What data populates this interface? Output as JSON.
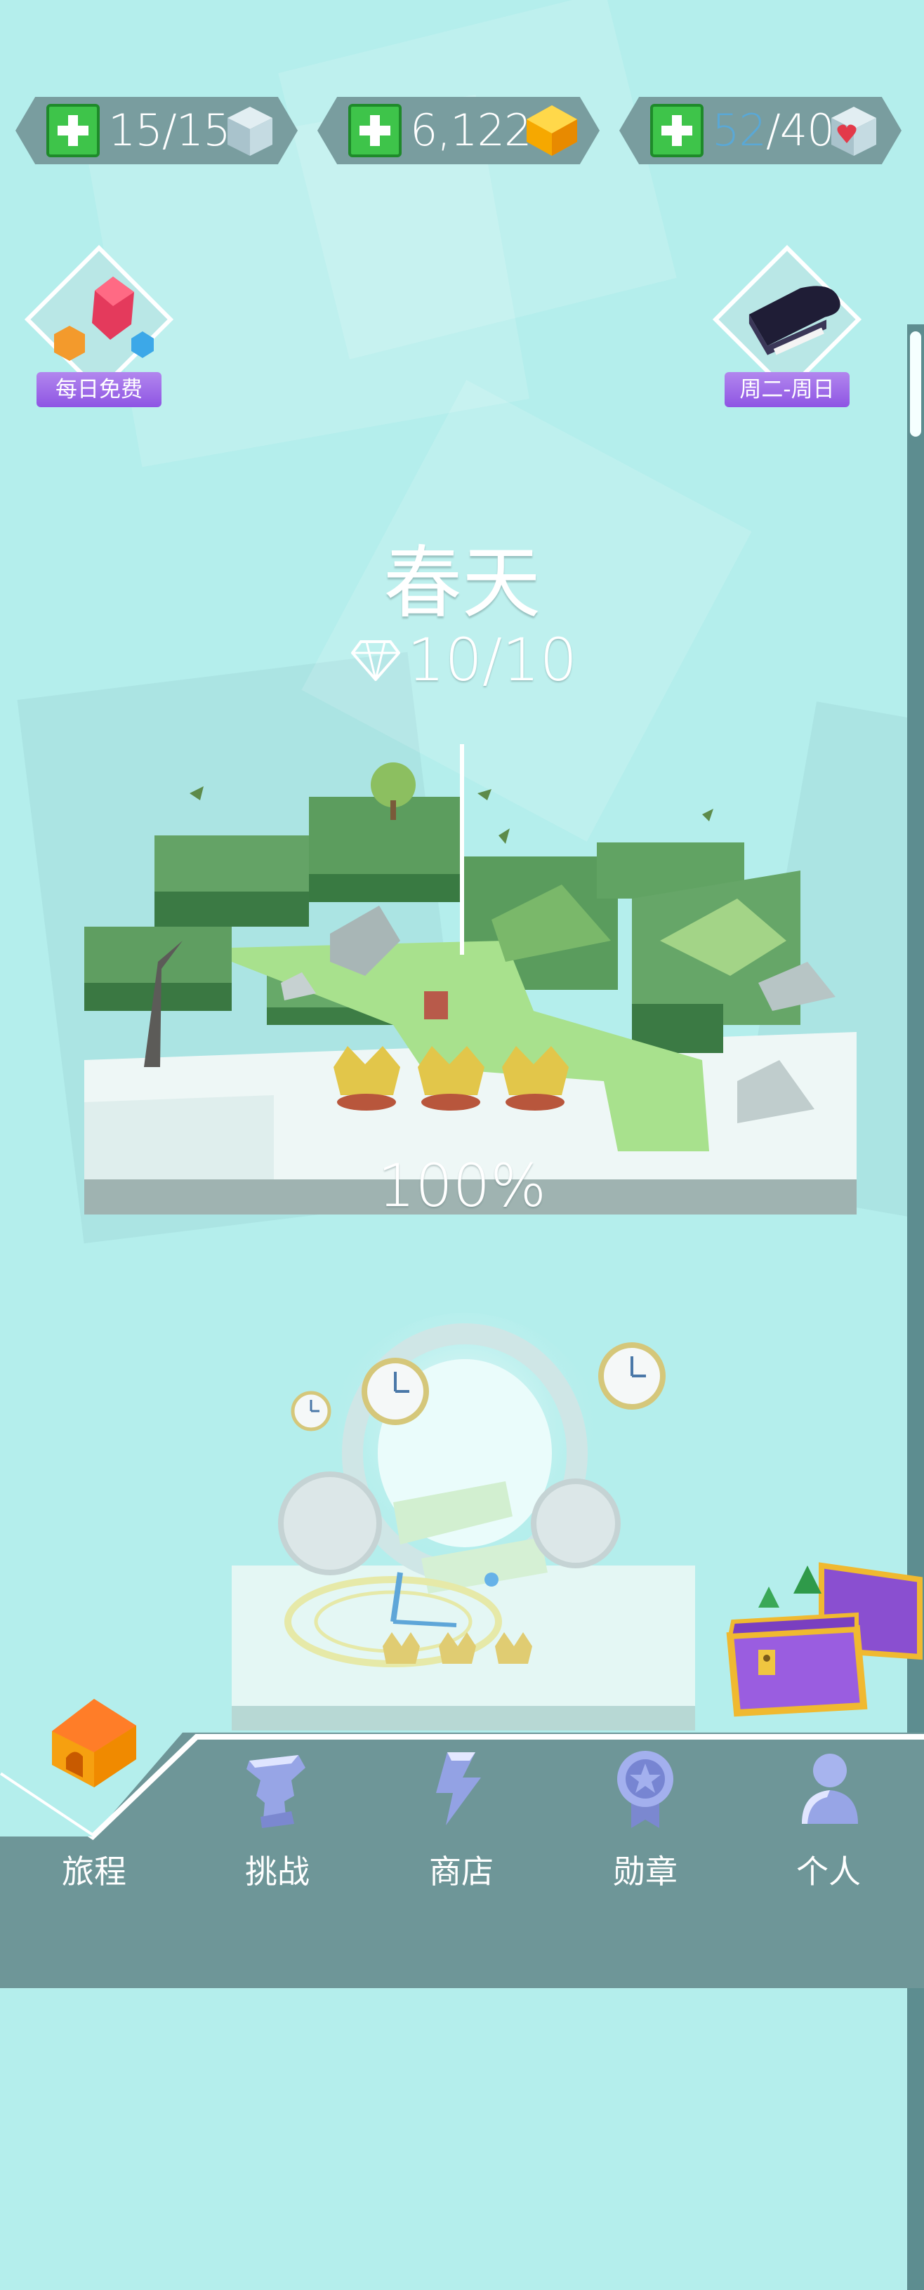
{
  "resources": [
    {
      "current": "15",
      "max": "15",
      "sep": "/",
      "icon": "cube-icon"
    },
    {
      "value": "6,122",
      "icon": "gold-gem-icon"
    },
    {
      "current": "52",
      "max": "40",
      "sep": "/",
      "icon": "heart-cube-icon"
    }
  ],
  "badges": {
    "left": {
      "label": "每日免费",
      "icon": "gems-icon"
    },
    "right": {
      "label": "周二-周日",
      "icon": "piano-icon"
    }
  },
  "level": {
    "title": "春天",
    "gems": "10/10",
    "progress_text": "100%",
    "progress": 1.0
  },
  "nav": [
    {
      "label": "旅程",
      "icon": "house-icon"
    },
    {
      "label": "挑战",
      "icon": "trophy-icon"
    },
    {
      "label": "商店",
      "icon": "shop-icon"
    },
    {
      "label": "勋章",
      "icon": "medal-icon"
    },
    {
      "label": "个人",
      "icon": "person-icon"
    }
  ],
  "colors": {
    "background": "#b4eeec",
    "nav": "#6d9597",
    "plus_green": "#3ec44a",
    "badge_purple": "#9b63e8"
  }
}
